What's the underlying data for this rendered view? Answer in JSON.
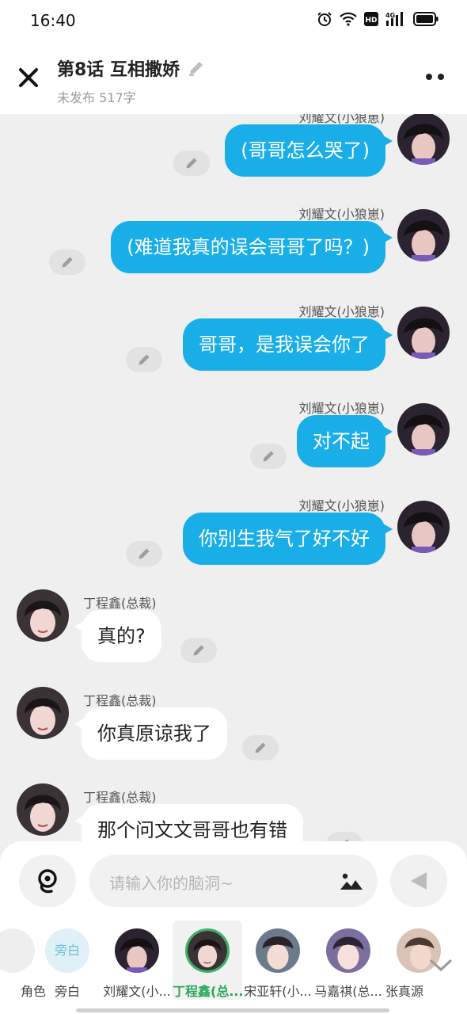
{
  "status": {
    "time": "16:40"
  },
  "header": {
    "title": "第8话  互相撒娇",
    "subtitle": "未发布 517字"
  },
  "messages": [
    {
      "side": "right",
      "name": "刘耀文(小狼崽)",
      "text": "(哥哥怎么哭了)"
    },
    {
      "side": "right",
      "name": "刘耀文(小狼崽)",
      "text": "(难道我真的误会哥哥了吗？)"
    },
    {
      "side": "right",
      "name": "刘耀文(小狼崽)",
      "text": "哥哥，是我误会你了"
    },
    {
      "side": "right",
      "name": "刘耀文(小狼崽)",
      "text": "对不起"
    },
    {
      "side": "right",
      "name": "刘耀文(小狼崽)",
      "text": "你别生我气了好不好"
    },
    {
      "side": "left",
      "name": "丁程鑫(总裁)",
      "text": "真的?"
    },
    {
      "side": "left",
      "name": "丁程鑫(总裁)",
      "text": "你真原谅我了"
    },
    {
      "side": "left",
      "name": "丁程鑫(总裁)",
      "text": "那个问文文哥哥也有错"
    }
  ],
  "composer": {
    "placeholder": "请输入你的脑洞~"
  },
  "roles": [
    {
      "label": "角色",
      "selected": false
    },
    {
      "label": "旁白",
      "avatar_text": "旁白",
      "selected": false
    },
    {
      "label": "刘耀文(小...",
      "selected": false
    },
    {
      "label": "丁程鑫(总...",
      "selected": true
    },
    {
      "label": "宋亚轩(小...",
      "selected": false
    },
    {
      "label": "马嘉祺(总...",
      "selected": false
    },
    {
      "label": "张真源",
      "selected": false
    }
  ],
  "colors": {
    "accent": "#1aaee8",
    "selected_green": "#39b26a"
  }
}
